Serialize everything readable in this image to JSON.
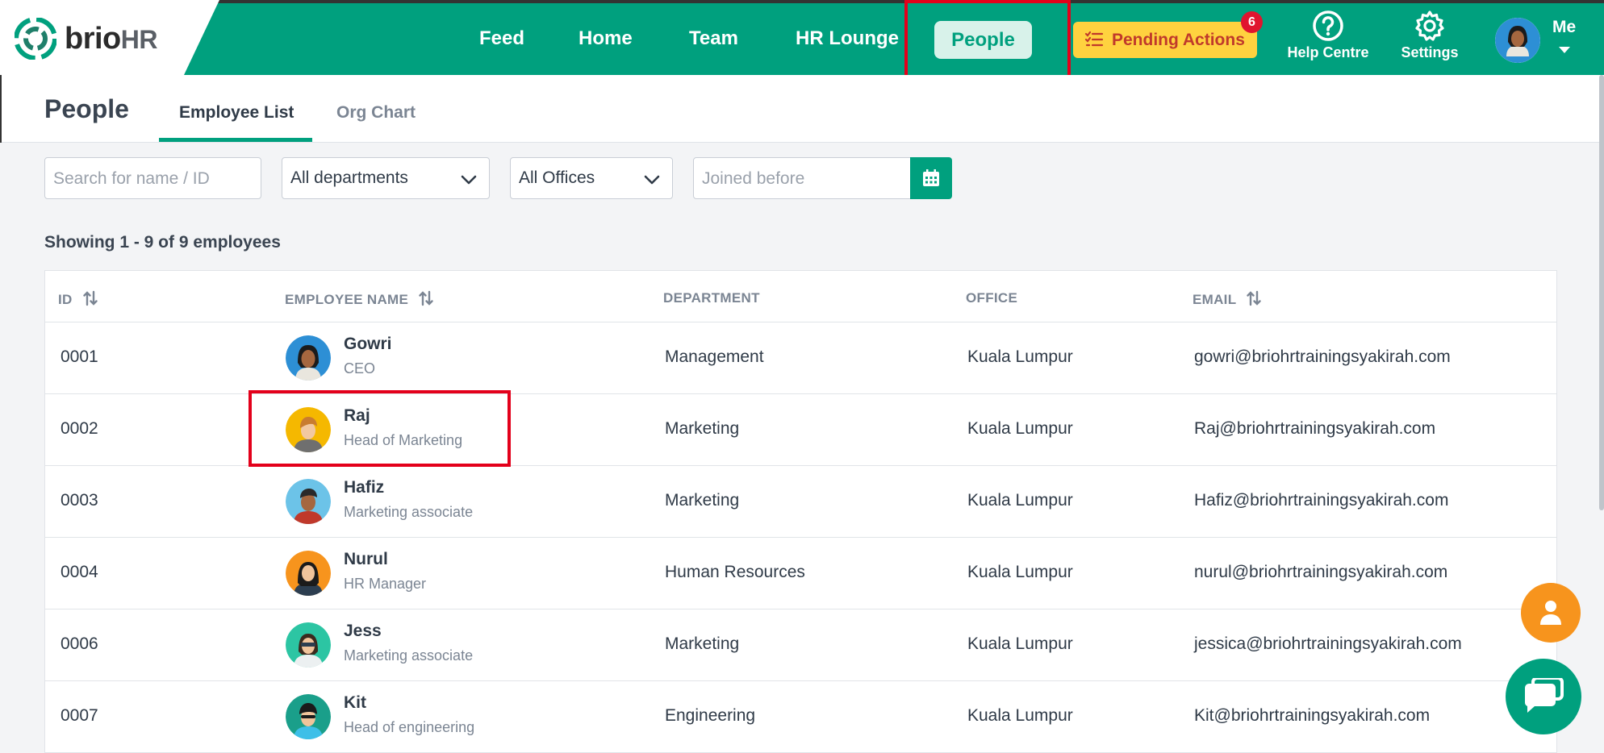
{
  "brand": {
    "name": "brio",
    "suffix": "HR"
  },
  "nav": {
    "feed": "Feed",
    "home": "Home",
    "team": "Team",
    "hr_lounge": "HR Lounge",
    "people": "People",
    "pending_actions": "Pending Actions",
    "pending_count": "6",
    "help": "Help Centre",
    "settings": "Settings",
    "me": "Me"
  },
  "page": {
    "title": "People",
    "tabs": [
      {
        "label": "Employee List",
        "active": true
      },
      {
        "label": "Org Chart",
        "active": false
      }
    ]
  },
  "filters": {
    "search_placeholder": "Search for name / ID",
    "department": "All departments",
    "office": "All Offices",
    "joined_placeholder": "Joined before"
  },
  "summary": "Showing 1 - 9 of 9 employees",
  "table": {
    "headers": {
      "id": "ID",
      "name": "EMPLOYEE NAME",
      "department": "DEPARTMENT",
      "office": "OFFICE",
      "email": "EMAIL"
    },
    "rows": [
      {
        "id": "0001",
        "name": "Gowri",
        "title": "CEO",
        "department": "Management",
        "office": "Kuala Lumpur",
        "email": "gowri@briohrtrainingsyakirah.com",
        "avatar_bg": "#2d8fd5"
      },
      {
        "id": "0002",
        "name": "Raj",
        "title": "Head of Marketing",
        "department": "Marketing",
        "office": "Kuala Lumpur",
        "email": "Raj@briohrtrainingsyakirah.com",
        "avatar_bg": "#f5b800"
      },
      {
        "id": "0003",
        "name": "Hafiz",
        "title": "Marketing associate",
        "department": "Marketing",
        "office": "Kuala Lumpur",
        "email": "Hafiz@briohrtrainingsyakirah.com",
        "avatar_bg": "#6cc3e8"
      },
      {
        "id": "0004",
        "name": "Nurul",
        "title": "HR Manager",
        "department": "Human Resources",
        "office": "Kuala Lumpur",
        "email": "nurul@briohrtrainingsyakirah.com",
        "avatar_bg": "#f7941d"
      },
      {
        "id": "0006",
        "name": "Jess",
        "title": "Marketing associate",
        "department": "Marketing",
        "office": "Kuala Lumpur",
        "email": "jessica@briohrtrainingsyakirah.com",
        "avatar_bg": "#2cc5a3"
      },
      {
        "id": "0007",
        "name": "Kit",
        "title": "Head of engineering",
        "department": "Engineering",
        "office": "Kuala Lumpur",
        "email": "Kit@briohrtrainingsyakirah.com",
        "avatar_bg": "#1a9f8a"
      }
    ]
  },
  "colors": {
    "brand_green": "#00a07e",
    "pending_yellow": "#ffd23f",
    "highlight_red": "#e3001b",
    "fab_orange": "#f7941d"
  },
  "icons": [
    "brio-logo-icon",
    "checklist-icon",
    "help-icon",
    "gear-icon",
    "chevron-down-icon",
    "calendar-icon",
    "sort-icon",
    "person-icon",
    "chat-icon"
  ]
}
